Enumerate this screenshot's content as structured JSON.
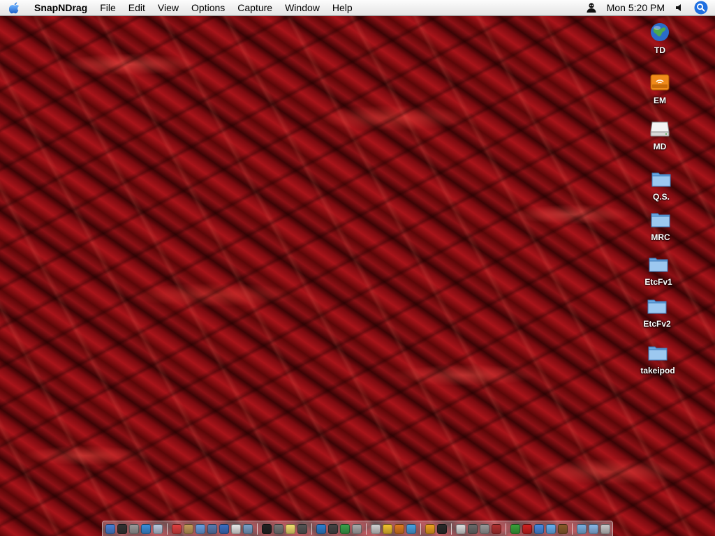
{
  "menubar": {
    "app_name": "SnapNDrag",
    "menus": [
      "File",
      "Edit",
      "View",
      "Options",
      "Capture",
      "Window",
      "Help"
    ],
    "clock": "Mon 5:20 PM",
    "icons": [
      "apple-logo-icon",
      "user-silhouette-icon",
      "speaker-volume-icon",
      "spotlight-search-icon"
    ]
  },
  "desktop_icons": [
    {
      "label": "TD",
      "icon": "globe-drive-icon"
    },
    {
      "label": "EM",
      "icon": "orange-firewire-drive-icon"
    },
    {
      "label": "MD",
      "icon": "white-hard-drive-icon"
    },
    {
      "label": "Q.S.",
      "icon": "folder-icon"
    },
    {
      "label": "MRC",
      "icon": "folder-icon"
    },
    {
      "label": "EtcFv1",
      "icon": "folder-icon"
    },
    {
      "label": "EtcFv2",
      "icon": "folder-icon"
    },
    {
      "label": "takeipod",
      "icon": "folder-icon"
    }
  ],
  "wallpaper": {
    "description": "red chili peppers",
    "base_color": "#6b0a0d",
    "highlight_color": "#c8202a"
  },
  "dock": {
    "items": [
      {
        "icon": "finder-icon",
        "color": "#4a7fd4"
      },
      {
        "icon": "dashboard-icon",
        "color": "#333333"
      },
      {
        "icon": "system-preferences-icon",
        "color": "#9a9a9a"
      },
      {
        "icon": "safari-icon",
        "color": "#3b8fdc"
      },
      {
        "icon": "mail-icon",
        "color": "#b9c8dd"
      },
      {
        "icon": "separator",
        "color": ""
      },
      {
        "icon": "ical-icon",
        "color": "#e04040"
      },
      {
        "icon": "address-book-icon",
        "color": "#c49a5a"
      },
      {
        "icon": "itunes-icon",
        "color": "#6a9ee0"
      },
      {
        "icon": "iphoto-icon",
        "color": "#5a7ab0"
      },
      {
        "icon": "quicktime-icon",
        "color": "#3b6ec2"
      },
      {
        "icon": "textedit-icon",
        "color": "#e8e8e8"
      },
      {
        "icon": "preview-icon",
        "color": "#7aa0c8"
      },
      {
        "icon": "separator",
        "color": ""
      },
      {
        "icon": "terminal-icon",
        "color": "#222222"
      },
      {
        "icon": "calculator-icon",
        "color": "#777777"
      },
      {
        "icon": "stickies-icon",
        "color": "#f4e070"
      },
      {
        "icon": "chess-icon",
        "color": "#555555"
      },
      {
        "icon": "separator",
        "color": ""
      },
      {
        "icon": "network-globe-icon",
        "color": "#2f7fcf"
      },
      {
        "icon": "console-icon",
        "color": "#444444"
      },
      {
        "icon": "activity-monitor-icon",
        "color": "#3aa04a"
      },
      {
        "icon": "disk-utility-icon",
        "color": "#aaaaaa"
      },
      {
        "icon": "separator",
        "color": ""
      },
      {
        "icon": "ical-small-icon",
        "color": "#d0d0d0"
      },
      {
        "icon": "stickies-yellow-icon",
        "color": "#f2c230"
      },
      {
        "icon": "snapndrag-icon",
        "color": "#e07a20"
      },
      {
        "icon": "timer-icon",
        "color": "#4aa0e0"
      },
      {
        "icon": "separator",
        "color": ""
      },
      {
        "icon": "finder-face-icon",
        "color": "#f0a020"
      },
      {
        "icon": "movie-clapper-icon",
        "color": "#2a2a2a"
      },
      {
        "icon": "separator",
        "color": ""
      },
      {
        "icon": "printer-icon",
        "color": "#dddddd"
      },
      {
        "icon": "image-capture-icon",
        "color": "#6a6a6a"
      },
      {
        "icon": "scanner-icon",
        "color": "#999999"
      },
      {
        "icon": "photo-booth-icon",
        "color": "#b03030"
      },
      {
        "icon": "separator",
        "color": ""
      },
      {
        "icon": "frog-icon",
        "color": "#3aa03a"
      },
      {
        "icon": "red-face-icon",
        "color": "#d02020"
      },
      {
        "icon": "ichat-icon",
        "color": "#4a8ae0"
      },
      {
        "icon": "chat-bubble-icon",
        "color": "#6ab0f0"
      },
      {
        "icon": "sherlock-icon",
        "color": "#8a5a2a"
      },
      {
        "icon": "separator",
        "color": ""
      },
      {
        "icon": "documents-folder-icon",
        "color": "#7ab0e0"
      },
      {
        "icon": "downloads-folder-icon",
        "color": "#8ab8e8"
      },
      {
        "icon": "trash-icon",
        "color": "#c8c8c8"
      }
    ]
  }
}
